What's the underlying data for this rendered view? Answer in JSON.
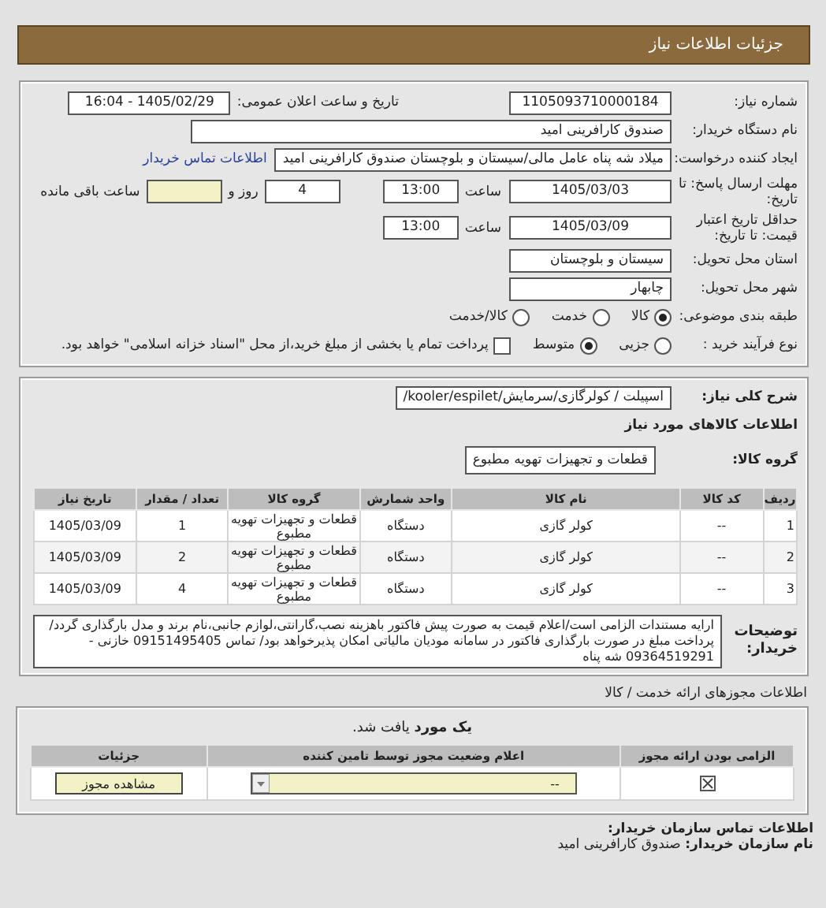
{
  "header": {
    "title": "جزئیات اطلاعات نیاز"
  },
  "need_number": {
    "label": "شماره نیاز:",
    "value": "1105093710000184"
  },
  "announce": {
    "label": "تاریخ و ساعت اعلان عمومی:",
    "value": "1405/02/29 - 16:04"
  },
  "buyer": {
    "label": "نام دستگاه خریدار:",
    "value": "صندوق کارافرینی امید"
  },
  "requester": {
    "label": "ایجاد کننده درخواست:",
    "value": "میلاد شه پناه عامل مالی/سیستان و بلوچستان صندوق کارافرینی امید",
    "link": "اطلاعات تماس خریدار"
  },
  "deadline": {
    "label": "مهلت ارسال پاسخ: تا تاریخ:",
    "date": "1405/03/03",
    "time_label": "ساعت",
    "time": "13:00",
    "days": "4",
    "days_label": "روز و",
    "remaining_label": "ساعت باقی مانده"
  },
  "validity": {
    "label": "حداقل تاریخ اعتبار قیمت: تا تاریخ:",
    "date": "1405/03/09",
    "time_label": "ساعت",
    "time": "13:00"
  },
  "province": {
    "label": "استان محل تحویل:",
    "value": "سیستان و بلوچستان"
  },
  "city": {
    "label": "شهر محل تحویل:",
    "value": "چابهار"
  },
  "category": {
    "label": "طبقه بندی موضوعی:",
    "options": [
      {
        "label": "کالا",
        "selected": true
      },
      {
        "label": "خدمت",
        "selected": false
      },
      {
        "label": "کالا/خدمت",
        "selected": false
      }
    ]
  },
  "process": {
    "label": "نوع فرآیند خرید :",
    "options": [
      {
        "label": "جزیی",
        "selected": false
      },
      {
        "label": "متوسط",
        "selected": true
      }
    ],
    "treasury": {
      "checked": false,
      "text": "پرداخت تمام یا بخشی از مبلغ خرید،از محل \"اسناد خزانه اسلامی\" خواهد بود."
    }
  },
  "keyword": {
    "label": "شرح کلی نیاز:",
    "value": "اسپیلت / کولرگازی/سرمایش/kooler/espilet/"
  },
  "goods_title": "اطلاعات کالاهای مورد نیاز",
  "goods_group": {
    "label": "گروه کالا:",
    "value": "قطعات و تجهیزات تهویه مطبوع"
  },
  "goods_table": {
    "columns": [
      "ردیف",
      "کد کالا",
      "نام کالا",
      "واحد شمارش",
      "گروه کالا",
      "تعداد / مقدار",
      "تاریخ نیاز"
    ],
    "rows": [
      [
        "1",
        "--",
        "کولر گازی",
        "دستگاه",
        "قطعات و تجهیزات تهویه مطبوع",
        "1",
        "1405/03/09"
      ],
      [
        "2",
        "--",
        "کولر گازی",
        "دستگاه",
        "قطعات و تجهیزات تهویه مطبوع",
        "2",
        "1405/03/09"
      ],
      [
        "3",
        "--",
        "کولر گازی",
        "دستگاه",
        "قطعات و تجهیزات تهویه مطبوع",
        "4",
        "1405/03/09"
      ]
    ]
  },
  "description": {
    "label": "توضیحات خریدار:",
    "text": "ارایه مستندات الزامی است/اعلام قیمت به صورت پیش فاکتور باهزینه نصب،گارانتی،لوازم جانبی،نام برند و مدل بارگذاری گردد/پرداخت مبلغ در صورت بارگذاری فاکتور در سامانه مودیان مالیاتی امکان پذیرخواهد بود/ تماس 09151495405 خازنی - 09364519291 شه پناه"
  },
  "licenses": {
    "title": "اطلاعات مجوزهای ارائه خدمت / کالا",
    "found": "**یک مورد** یافت شد.",
    "columns": [
      "الزامی بودن ارائه مجوز",
      "اعلام وضعیت مجوز توسط تامین کننده",
      "جزئیات"
    ],
    "rows": [
      {
        "required": true,
        "status": "--",
        "button": "مشاهده مجوز"
      }
    ]
  },
  "contact": {
    "title": "اطلاعات تماس سازمان خریدار:",
    "name_label": "نام سازمان خریدار:",
    "name": "صندوق کارافرینی امید"
  }
}
